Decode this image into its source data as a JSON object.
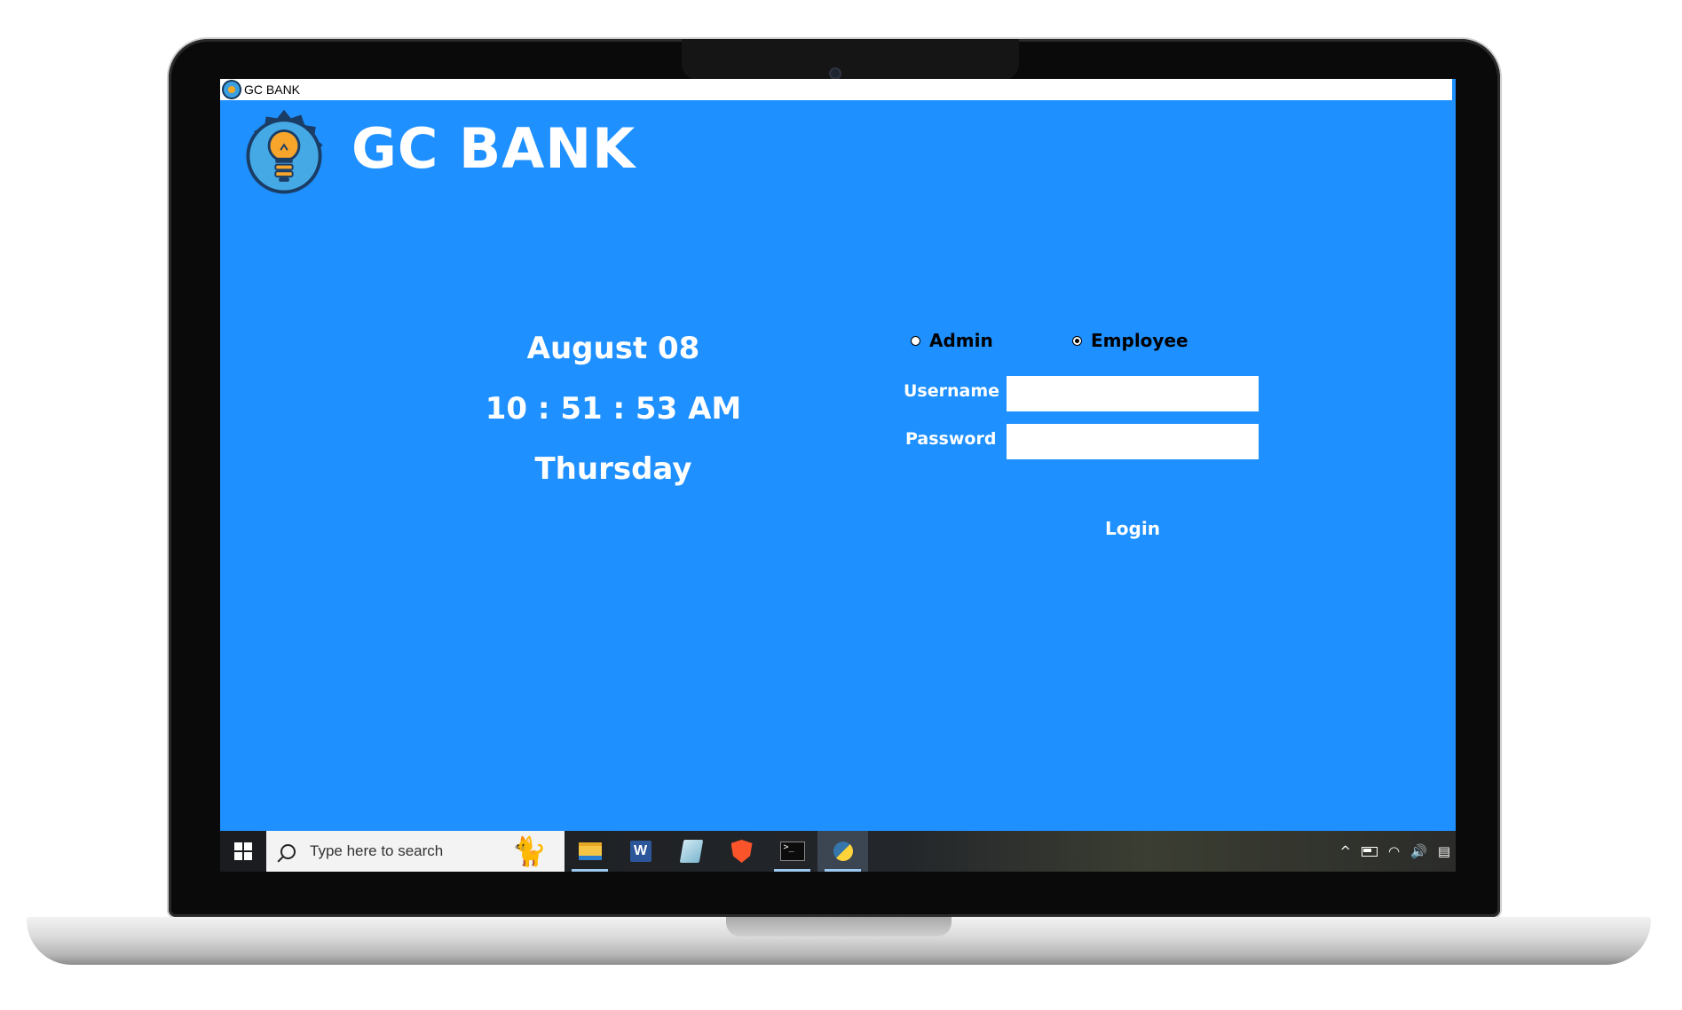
{
  "window": {
    "title": "GC BANK"
  },
  "brand": {
    "name": "GC BANK",
    "logo_icon": "lightbulb-gear-icon"
  },
  "clock": {
    "date": "August 08",
    "time": "10 : 51 : 53 AM",
    "day": "Thursday"
  },
  "login": {
    "roles": [
      {
        "label": "Admin",
        "selected": false
      },
      {
        "label": "Employee",
        "selected": true
      }
    ],
    "username_label": "Username",
    "username_value": "",
    "password_label": "Password",
    "password_value": "",
    "login_button": "Login"
  },
  "taskbar": {
    "search_placeholder": "Type here to search",
    "apps": [
      {
        "name": "file-explorer-icon"
      },
      {
        "name": "word-icon"
      },
      {
        "name": "notes-icon"
      },
      {
        "name": "brave-icon"
      },
      {
        "name": "terminal-icon"
      },
      {
        "name": "python-icon"
      }
    ]
  },
  "colors": {
    "app_background": "#1e90ff",
    "text_primary": "#ffffff",
    "radio_text": "#000000"
  }
}
